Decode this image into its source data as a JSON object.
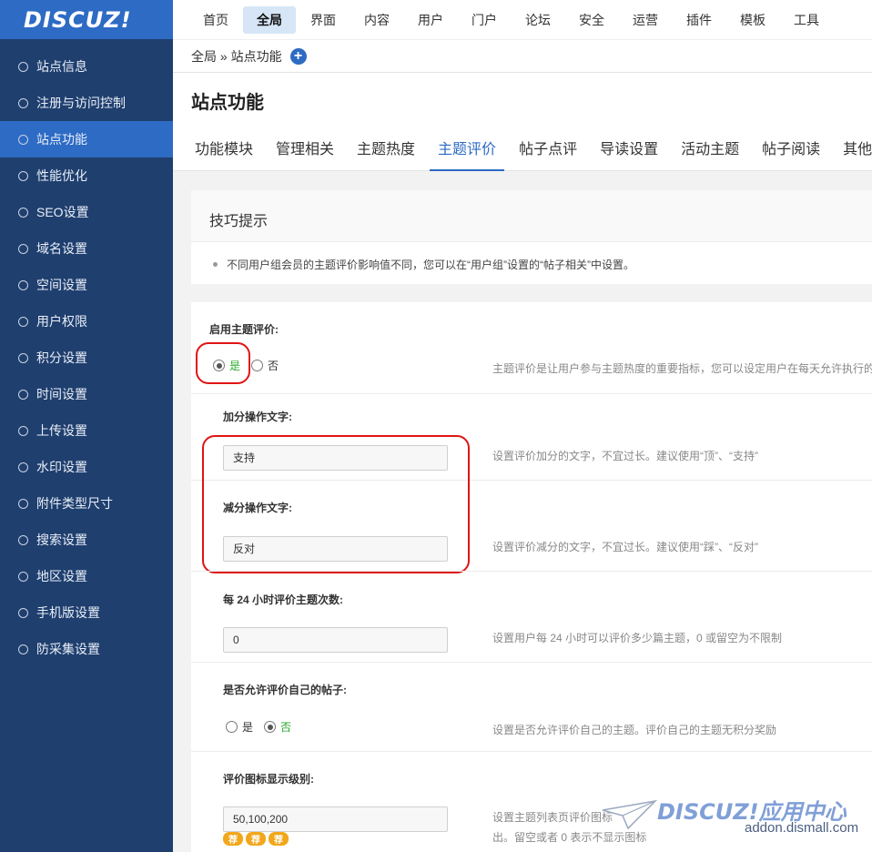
{
  "logo": "DISCUZ!",
  "sidebar": {
    "items": [
      {
        "label": "站点信息"
      },
      {
        "label": "注册与访问控制"
      },
      {
        "label": "站点功能",
        "active": true
      },
      {
        "label": "性能优化"
      },
      {
        "label": "SEO设置"
      },
      {
        "label": "域名设置"
      },
      {
        "label": "空间设置"
      },
      {
        "label": "用户权限"
      },
      {
        "label": "积分设置"
      },
      {
        "label": "时间设置"
      },
      {
        "label": "上传设置"
      },
      {
        "label": "水印设置"
      },
      {
        "label": "附件类型尺寸"
      },
      {
        "label": "搜索设置"
      },
      {
        "label": "地区设置"
      },
      {
        "label": "手机版设置"
      },
      {
        "label": "防采集设置"
      }
    ]
  },
  "topnav": {
    "items": [
      "首页",
      "全局",
      "界面",
      "内容",
      "用户",
      "门户",
      "论坛",
      "安全",
      "运营",
      "插件",
      "模板",
      "工具"
    ],
    "active_index": 1
  },
  "breadcrumb": {
    "text": "全局 » 站点功能",
    "add_icon": "plus-icon"
  },
  "page": {
    "title": "站点功能",
    "tabs": [
      "功能模块",
      "管理相关",
      "主题热度",
      "主题评价",
      "帖子点评",
      "导读设置",
      "活动主题",
      "帖子阅读",
      "其他"
    ],
    "active_tab_index": 3
  },
  "tips": {
    "title": "技巧提示",
    "items": [
      "不同用户组会员的主题评价影响值不同，您可以在“用户组”设置的“帖子相关”中设置。"
    ]
  },
  "form": {
    "enable": {
      "label": "启用主题评价:",
      "yes": "是",
      "no": "否",
      "selected": "yes",
      "hint": "主题评价是让用户参与主题热度的重要指标，您可以设定用户在每天允许执行的"
    },
    "plus_text": {
      "label": "加分操作文字:",
      "value": "支持",
      "hint": "设置评价加分的文字，不宜过长。建议使用“顶”、“支持”"
    },
    "minus_text": {
      "label": "减分操作文字:",
      "value": "反对",
      "hint": "设置评价减分的文字，不宜过长。建议使用“踩”、“反对”"
    },
    "daily_limit": {
      "label": "每 24 小时评价主题次数:",
      "value": "0",
      "hint": "设置用户每 24 小时可以评价多少篇主题，0 或留空为不限制"
    },
    "allow_self": {
      "label": "是否允许评价自己的帖子:",
      "yes": "是",
      "no": "否",
      "selected": "no",
      "hint": "设置是否允许评价自己的主题。评价自己的主题无积分奖励"
    },
    "icon_levels": {
      "label": "评价图标显示级别:",
      "value": "50,100,200",
      "hint_line1": "设置主题列表页评价图标",
      "hint_line2": "出。留空或者 0 表示不显示图标",
      "badges": [
        "荐",
        "荐",
        "荐"
      ]
    }
  },
  "watermark": {
    "title": "DISCUZ!应用中心",
    "url": "addon.dismall.com"
  },
  "colors": {
    "sidebar": "#1f3f6e",
    "accent": "#2d6bc4",
    "highlight": "#e01414",
    "green": "#2aa82a",
    "badge": "#f2a71b"
  }
}
